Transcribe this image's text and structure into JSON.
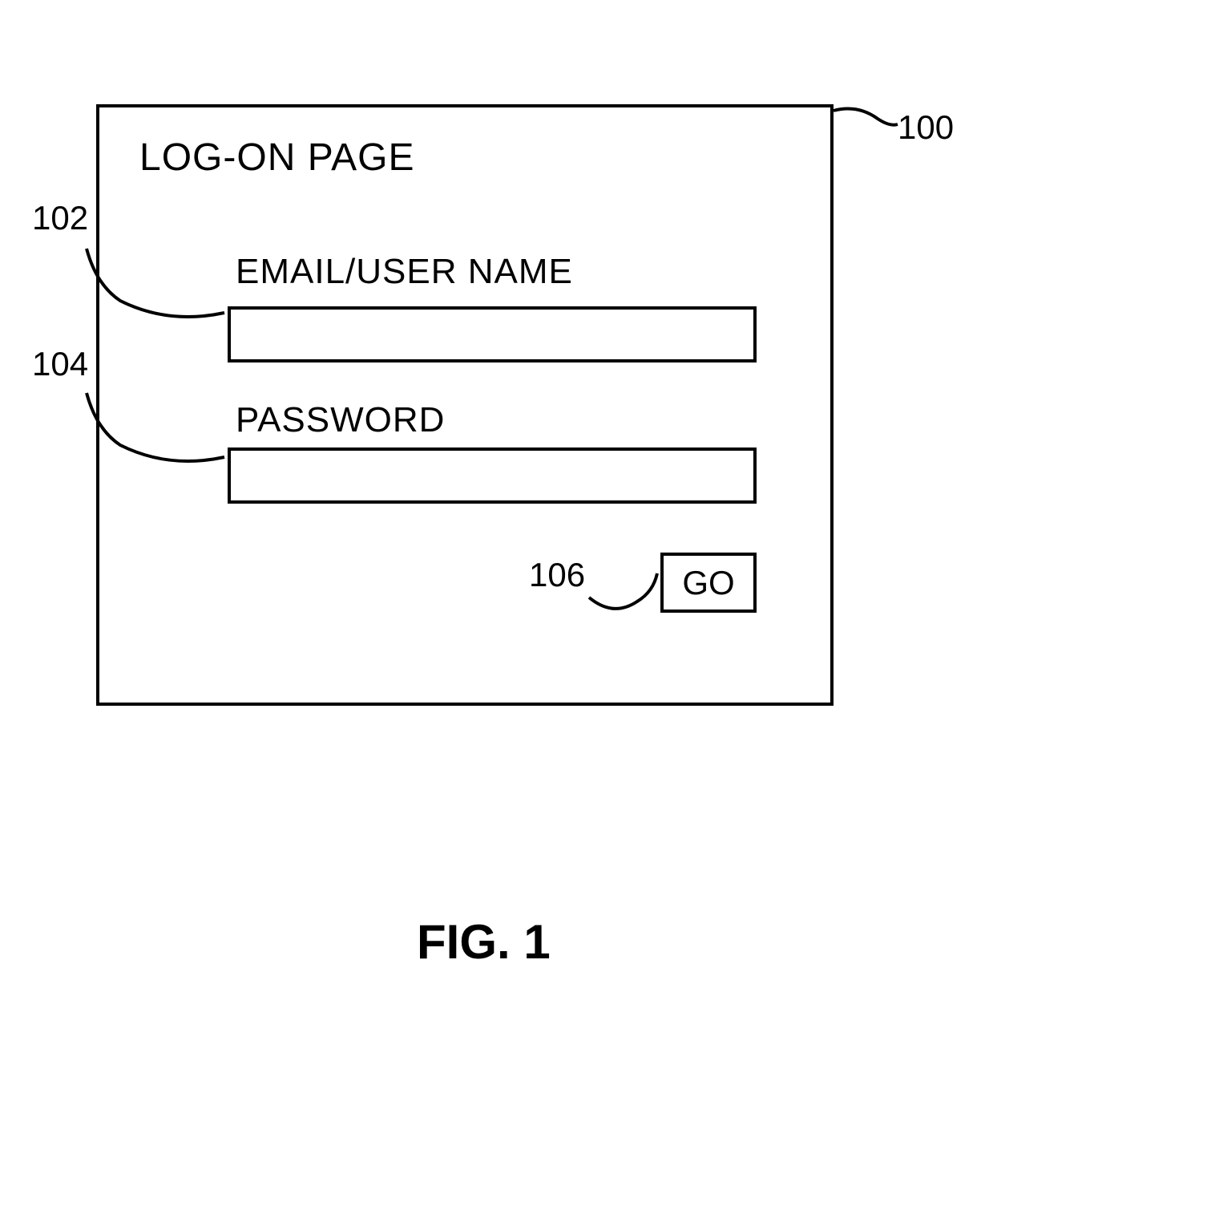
{
  "login_box": {
    "title": "LOG-ON PAGE",
    "email_label": "EMAIL/USER NAME",
    "email_value": "",
    "password_label": "PASSWORD",
    "password_value": "",
    "go_label": "GO"
  },
  "callouts": {
    "box": "100",
    "email_field": "102",
    "password_field": "104",
    "go_button": "106"
  },
  "figure_caption": "FIG. 1"
}
